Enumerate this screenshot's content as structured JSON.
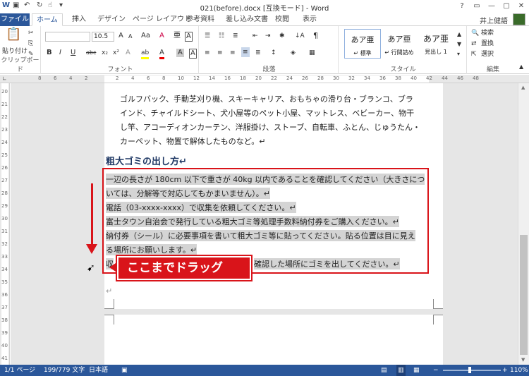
{
  "window": {
    "title": "021(before).docx [互換モード] - Word",
    "help": "?",
    "ribbon_display": "▭",
    "minimize": "—",
    "maximize": "▢",
    "close": "✕",
    "user": "井上健語"
  },
  "tabs": [
    "ファイル",
    "ホーム",
    "挿入",
    "デザイン",
    "ページ レイアウト",
    "参考資料",
    "差し込み文書",
    "校閲",
    "表示"
  ],
  "ribbon": {
    "clipboard": {
      "paste": "貼り付け",
      "label": "クリップボード"
    },
    "font": {
      "size": "10.5",
      "label": "フォント",
      "bold": "B",
      "italic": "I",
      "underline": "U",
      "strike": "abc",
      "sub": "x₂",
      "sup": "x²",
      "grow": "A",
      "shrink": "A",
      "case": "Aa",
      "clear": "A",
      "effects": "A",
      "highlight": "ab",
      "color": "A",
      "shade": "A",
      "border": "A"
    },
    "paragraph": {
      "label": "段落",
      "sort": "↓A",
      "marks": "¶"
    },
    "styles": {
      "label": "スタイル",
      "items": [
        {
          "preview": "あア亜",
          "name": "↵ 標準"
        },
        {
          "preview": "あア亜",
          "name": "↵ 行間詰め"
        },
        {
          "preview": "あア亜",
          "name": "見出し 1"
        }
      ]
    },
    "editing": {
      "label": "編集",
      "search": "検索",
      "replace": "置換",
      "select": "選択"
    }
  },
  "ruler_numbers": [
    "8",
    "6",
    "4",
    "2",
    "",
    "2",
    "4",
    "6",
    "8",
    "10",
    "12",
    "14",
    "16",
    "18",
    "20",
    "22",
    "24",
    "26",
    "28",
    "30",
    "32",
    "34",
    "36",
    "38",
    "40",
    "42",
    "44",
    "46",
    "48"
  ],
  "vruler_numbers": [
    "20",
    "21",
    "22",
    "23",
    "24",
    "25",
    "26",
    "27",
    "28",
    "29",
    "30",
    "31",
    "32",
    "33",
    "34",
    "35",
    "36",
    "37",
    "38",
    "39",
    "40",
    "41"
  ],
  "document": {
    "intro_lines": [
      "ゴルフバック、手動芝刈り機、スキーキャリア、おもちゃの滑り台・ブランコ、ブラ",
      "インド、チャイルドシート、犬小屋等のペット小屋、マットレス、ベビーカー、物干",
      "し竿、アコーディオンカーテン、洋服掛け、ストーブ、自転車、ふとん、じゅうたん・",
      "カーペット、物置で解体したものなど。↵"
    ],
    "heading": "粗大ゴミの出し方↵",
    "selected_lines": [
      "一辺の長さが 180cm 以下で重さが 40kg 以内であることを確認してください（大きさにつ",
      "いては、分解等で対応してもかまいません）。↵",
      "電話（03-xxxx-xxxx）で収集を依頼してください。↵",
      "富士タウン自治会で発行している粗大ゴミ等処理手数料納付券をご購入ください。↵",
      "納付券（シール）に必要事項を書いて粗大ゴミ等に貼ってください。貼る位置は目に見え",
      "る場所にお願いします。↵",
      "収"
    ],
    "last_line_tail": "確認した場所にゴミを出してください。↵",
    "empty_mark": "↵"
  },
  "annotation": {
    "callout": "ここまでドラッグ"
  },
  "status": {
    "page": "1/1 ページ",
    "words": "199/779 文字",
    "lang": "日本語",
    "zoom": "110%",
    "zoom_minus": "−",
    "zoom_plus": "+"
  },
  "colors": {
    "accent": "#2b579a",
    "highlight_red": "#d9141a",
    "selection": "#d4d4d4"
  }
}
